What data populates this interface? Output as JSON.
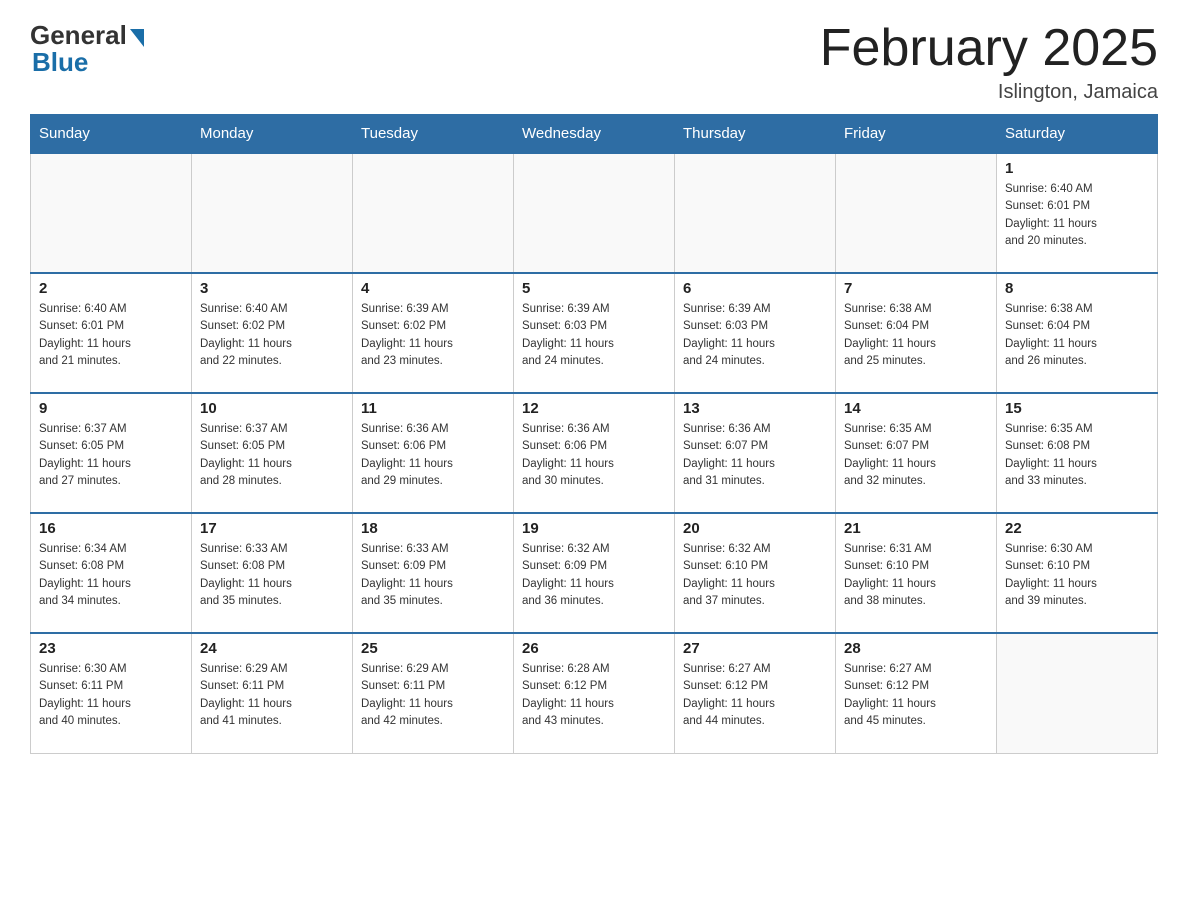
{
  "header": {
    "logo": {
      "general": "General",
      "blue": "Blue"
    },
    "title": "February 2025",
    "location": "Islington, Jamaica"
  },
  "days_of_week": [
    "Sunday",
    "Monday",
    "Tuesday",
    "Wednesday",
    "Thursday",
    "Friday",
    "Saturday"
  ],
  "weeks": [
    [
      {
        "day": "",
        "info": ""
      },
      {
        "day": "",
        "info": ""
      },
      {
        "day": "",
        "info": ""
      },
      {
        "day": "",
        "info": ""
      },
      {
        "day": "",
        "info": ""
      },
      {
        "day": "",
        "info": ""
      },
      {
        "day": "1",
        "info": "Sunrise: 6:40 AM\nSunset: 6:01 PM\nDaylight: 11 hours\nand 20 minutes."
      }
    ],
    [
      {
        "day": "2",
        "info": "Sunrise: 6:40 AM\nSunset: 6:01 PM\nDaylight: 11 hours\nand 21 minutes."
      },
      {
        "day": "3",
        "info": "Sunrise: 6:40 AM\nSunset: 6:02 PM\nDaylight: 11 hours\nand 22 minutes."
      },
      {
        "day": "4",
        "info": "Sunrise: 6:39 AM\nSunset: 6:02 PM\nDaylight: 11 hours\nand 23 minutes."
      },
      {
        "day": "5",
        "info": "Sunrise: 6:39 AM\nSunset: 6:03 PM\nDaylight: 11 hours\nand 24 minutes."
      },
      {
        "day": "6",
        "info": "Sunrise: 6:39 AM\nSunset: 6:03 PM\nDaylight: 11 hours\nand 24 minutes."
      },
      {
        "day": "7",
        "info": "Sunrise: 6:38 AM\nSunset: 6:04 PM\nDaylight: 11 hours\nand 25 minutes."
      },
      {
        "day": "8",
        "info": "Sunrise: 6:38 AM\nSunset: 6:04 PM\nDaylight: 11 hours\nand 26 minutes."
      }
    ],
    [
      {
        "day": "9",
        "info": "Sunrise: 6:37 AM\nSunset: 6:05 PM\nDaylight: 11 hours\nand 27 minutes."
      },
      {
        "day": "10",
        "info": "Sunrise: 6:37 AM\nSunset: 6:05 PM\nDaylight: 11 hours\nand 28 minutes."
      },
      {
        "day": "11",
        "info": "Sunrise: 6:36 AM\nSunset: 6:06 PM\nDaylight: 11 hours\nand 29 minutes."
      },
      {
        "day": "12",
        "info": "Sunrise: 6:36 AM\nSunset: 6:06 PM\nDaylight: 11 hours\nand 30 minutes."
      },
      {
        "day": "13",
        "info": "Sunrise: 6:36 AM\nSunset: 6:07 PM\nDaylight: 11 hours\nand 31 minutes."
      },
      {
        "day": "14",
        "info": "Sunrise: 6:35 AM\nSunset: 6:07 PM\nDaylight: 11 hours\nand 32 minutes."
      },
      {
        "day": "15",
        "info": "Sunrise: 6:35 AM\nSunset: 6:08 PM\nDaylight: 11 hours\nand 33 minutes."
      }
    ],
    [
      {
        "day": "16",
        "info": "Sunrise: 6:34 AM\nSunset: 6:08 PM\nDaylight: 11 hours\nand 34 minutes."
      },
      {
        "day": "17",
        "info": "Sunrise: 6:33 AM\nSunset: 6:08 PM\nDaylight: 11 hours\nand 35 minutes."
      },
      {
        "day": "18",
        "info": "Sunrise: 6:33 AM\nSunset: 6:09 PM\nDaylight: 11 hours\nand 35 minutes."
      },
      {
        "day": "19",
        "info": "Sunrise: 6:32 AM\nSunset: 6:09 PM\nDaylight: 11 hours\nand 36 minutes."
      },
      {
        "day": "20",
        "info": "Sunrise: 6:32 AM\nSunset: 6:10 PM\nDaylight: 11 hours\nand 37 minutes."
      },
      {
        "day": "21",
        "info": "Sunrise: 6:31 AM\nSunset: 6:10 PM\nDaylight: 11 hours\nand 38 minutes."
      },
      {
        "day": "22",
        "info": "Sunrise: 6:30 AM\nSunset: 6:10 PM\nDaylight: 11 hours\nand 39 minutes."
      }
    ],
    [
      {
        "day": "23",
        "info": "Sunrise: 6:30 AM\nSunset: 6:11 PM\nDaylight: 11 hours\nand 40 minutes."
      },
      {
        "day": "24",
        "info": "Sunrise: 6:29 AM\nSunset: 6:11 PM\nDaylight: 11 hours\nand 41 minutes."
      },
      {
        "day": "25",
        "info": "Sunrise: 6:29 AM\nSunset: 6:11 PM\nDaylight: 11 hours\nand 42 minutes."
      },
      {
        "day": "26",
        "info": "Sunrise: 6:28 AM\nSunset: 6:12 PM\nDaylight: 11 hours\nand 43 minutes."
      },
      {
        "day": "27",
        "info": "Sunrise: 6:27 AM\nSunset: 6:12 PM\nDaylight: 11 hours\nand 44 minutes."
      },
      {
        "day": "28",
        "info": "Sunrise: 6:27 AM\nSunset: 6:12 PM\nDaylight: 11 hours\nand 45 minutes."
      },
      {
        "day": "",
        "info": ""
      }
    ]
  ]
}
